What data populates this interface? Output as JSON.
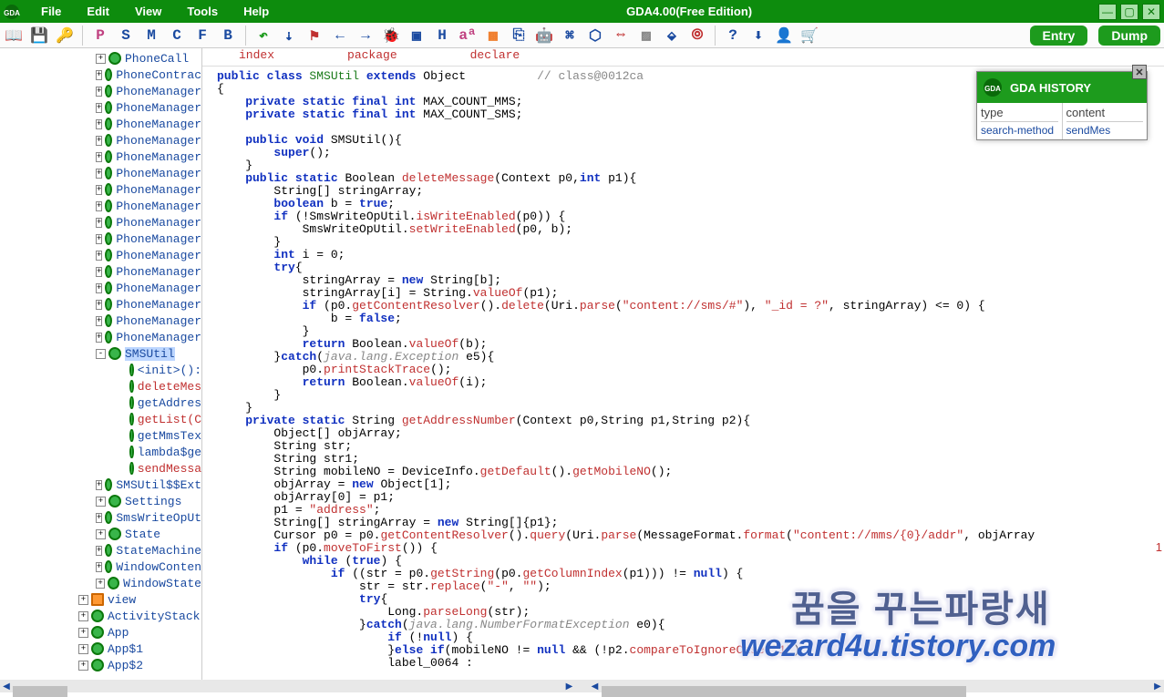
{
  "titlebar": {
    "menus": [
      "File",
      "Edit",
      "View",
      "Tools",
      "Help"
    ],
    "title": "GDA4.00(Free Edition)"
  },
  "toolbar": {
    "icons": [
      {
        "name": "open-icon",
        "glyph": "📖",
        "color": "#1a4aa0"
      },
      {
        "name": "save-icon",
        "glyph": "💾",
        "color": "#1a4aa0"
      },
      {
        "name": "key-icon",
        "glyph": "🔑",
        "color": "#c79b2a"
      }
    ],
    "letters": [
      {
        "name": "p-icon",
        "glyph": "P",
        "color": "#c04080"
      },
      {
        "name": "s-icon",
        "glyph": "S",
        "color": "#1a4aa0"
      },
      {
        "name": "m-icon",
        "glyph": "M",
        "color": "#1a4aa0"
      },
      {
        "name": "c-icon",
        "glyph": "C",
        "color": "#1a4aa0"
      },
      {
        "name": "f-icon",
        "glyph": "F",
        "color": "#1a4aa0"
      },
      {
        "name": "b-icon",
        "glyph": "B",
        "color": "#1a4aa0"
      }
    ],
    "tools": [
      {
        "name": "undo-icon",
        "glyph": "↶",
        "color": "#1d9b1d"
      },
      {
        "name": "bookmark-icon",
        "glyph": "⇣",
        "color": "#1a4aa0"
      },
      {
        "name": "flag-icon",
        "glyph": "⚑",
        "color": "#c03030"
      },
      {
        "name": "back-icon",
        "glyph": "←",
        "color": "#1a4aa0"
      },
      {
        "name": "forward-icon",
        "glyph": "→",
        "color": "#1a4aa0"
      },
      {
        "name": "bug-icon",
        "glyph": "🐞",
        "color": "#333"
      },
      {
        "name": "doc-icon",
        "glyph": "▣",
        "color": "#1a4aa0"
      },
      {
        "name": "h-icon",
        "glyph": "H",
        "color": "#1a4aa0"
      },
      {
        "name": "aa-icon",
        "glyph": "aª",
        "color": "#c04080"
      },
      {
        "name": "palette-icon",
        "glyph": "▦",
        "color": "#f08030"
      },
      {
        "name": "xml-icon",
        "glyph": "⎘",
        "color": "#1a4aa0"
      },
      {
        "name": "android-icon",
        "glyph": "🤖",
        "color": "#333"
      },
      {
        "name": "cmd-icon",
        "glyph": "⌘",
        "color": "#1a4aa0"
      },
      {
        "name": "link-icon",
        "glyph": "⬡",
        "color": "#1a4aa0"
      },
      {
        "name": "io-icon",
        "glyph": "⇔",
        "color": "#c03030"
      },
      {
        "name": "grid-icon",
        "glyph": "▨",
        "color": "#888"
      },
      {
        "name": "bucket-icon",
        "glyph": "⬙",
        "color": "#1a4aa0"
      },
      {
        "name": "finger-icon",
        "glyph": "⦾",
        "color": "#c03030"
      }
    ],
    "tools2": [
      {
        "name": "help-icon",
        "glyph": "?",
        "color": "#1a4aa0"
      },
      {
        "name": "download-icon",
        "glyph": "⬇",
        "color": "#1a4aa0"
      },
      {
        "name": "person-icon",
        "glyph": "👤",
        "color": "#333"
      },
      {
        "name": "cart-icon",
        "glyph": "🛒",
        "color": "#333"
      }
    ],
    "entry_label": "Entry",
    "dump_label": "Dump"
  },
  "tree": {
    "items": [
      {
        "indent": 105,
        "expand": "+",
        "icon": "class",
        "label": "PhoneCall"
      },
      {
        "indent": 105,
        "expand": "+",
        "icon": "class",
        "label": "PhoneContrac"
      },
      {
        "indent": 105,
        "expand": "+",
        "icon": "class",
        "label": "PhoneManager"
      },
      {
        "indent": 105,
        "expand": "+",
        "icon": "class",
        "label": "PhoneManager"
      },
      {
        "indent": 105,
        "expand": "+",
        "icon": "class",
        "label": "PhoneManager"
      },
      {
        "indent": 105,
        "expand": "+",
        "icon": "class",
        "label": "PhoneManager"
      },
      {
        "indent": 105,
        "expand": "+",
        "icon": "class",
        "label": "PhoneManager"
      },
      {
        "indent": 105,
        "expand": "+",
        "icon": "class",
        "label": "PhoneManager"
      },
      {
        "indent": 105,
        "expand": "+",
        "icon": "class",
        "label": "PhoneManager"
      },
      {
        "indent": 105,
        "expand": "+",
        "icon": "class",
        "label": "PhoneManager"
      },
      {
        "indent": 105,
        "expand": "+",
        "icon": "class",
        "label": "PhoneManager"
      },
      {
        "indent": 105,
        "expand": "+",
        "icon": "class",
        "label": "PhoneManager"
      },
      {
        "indent": 105,
        "expand": "+",
        "icon": "class",
        "label": "PhoneManager"
      },
      {
        "indent": 105,
        "expand": "+",
        "icon": "class",
        "label": "PhoneManager"
      },
      {
        "indent": 105,
        "expand": "+",
        "icon": "class",
        "label": "PhoneManager"
      },
      {
        "indent": 105,
        "expand": "+",
        "icon": "class",
        "label": "PhoneManager"
      },
      {
        "indent": 105,
        "expand": "+",
        "icon": "class",
        "label": "PhoneManager"
      },
      {
        "indent": 105,
        "expand": "+",
        "icon": "class",
        "label": "PhoneManager"
      },
      {
        "indent": 105,
        "expand": "-",
        "icon": "class",
        "label": "SMSUtil",
        "selected": true
      },
      {
        "indent": 142,
        "expand": "",
        "icon": "method",
        "label": "<init>():"
      },
      {
        "indent": 142,
        "expand": "",
        "icon": "method",
        "label": "deleteMes",
        "red": true
      },
      {
        "indent": 142,
        "expand": "",
        "icon": "method",
        "label": "getAddres"
      },
      {
        "indent": 142,
        "expand": "",
        "icon": "method",
        "label": "getList(C",
        "red": true
      },
      {
        "indent": 142,
        "expand": "",
        "icon": "method",
        "label": "getMmsTex"
      },
      {
        "indent": 142,
        "expand": "",
        "icon": "method",
        "label": "lambda$ge"
      },
      {
        "indent": 142,
        "expand": "",
        "icon": "method",
        "label": "sendMessa",
        "red": true
      },
      {
        "indent": 105,
        "expand": "+",
        "icon": "class",
        "label": "SMSUtil$$Ext"
      },
      {
        "indent": 105,
        "expand": "+",
        "icon": "class",
        "label": "Settings"
      },
      {
        "indent": 105,
        "expand": "+",
        "icon": "class",
        "label": "SmsWriteOpUt"
      },
      {
        "indent": 105,
        "expand": "+",
        "icon": "class",
        "label": "State"
      },
      {
        "indent": 105,
        "expand": "+",
        "icon": "class",
        "label": "StateMachine"
      },
      {
        "indent": 105,
        "expand": "+",
        "icon": "class",
        "label": "WindowConten"
      },
      {
        "indent": 105,
        "expand": "+",
        "icon": "class",
        "label": "WindowState"
      },
      {
        "indent": 86,
        "expand": "+",
        "icon": "pkg",
        "label": "view"
      },
      {
        "indent": 86,
        "expand": "+",
        "icon": "class",
        "label": "ActivityStack"
      },
      {
        "indent": 86,
        "expand": "+",
        "icon": "class",
        "label": "App"
      },
      {
        "indent": 86,
        "expand": "+",
        "icon": "class",
        "label": "App$1"
      },
      {
        "indent": 86,
        "expand": "+",
        "icon": "class",
        "label": "App$2"
      }
    ]
  },
  "code_tabs": {
    "index": "index",
    "package": "package",
    "declare": "declare"
  },
  "code": {
    "l1a": "public class ",
    "l1b": "SMSUtil ",
    "l1c": "extends ",
    "l1d": "Object",
    "l1e": "          // class@0012ca",
    "l2": "{",
    "l3a": "    private static final ",
    "l3b": "int ",
    "l3c": "MAX_COUNT_MMS;",
    "l4a": "    private static final ",
    "l4b": "int ",
    "l4c": "MAX_COUNT_SMS;",
    "l5": "",
    "l6a": "    public ",
    "l6b": "void ",
    "l6c": "SMSUtil(){",
    "l7a": "        super",
    "l7b": "();",
    "l8": "    }",
    "l9a": "    public static ",
    "l9b": "Boolean ",
    "l9c": "deleteMessage",
    "l9d": "(Context p0,",
    "l9e": "int ",
    "l9f": "p1){",
    "l10": "        String[] stringArray;",
    "l11a": "        boolean ",
    "l11b": "b = ",
    "l11c": "true",
    "l11d": ";",
    "l12a": "        if ",
    "l12b": "(!SmsWriteOpUtil.",
    "l12c": "isWriteEnabled",
    "l12d": "(p0)) {",
    "l13a": "            SmsWriteOpUtil.",
    "l13b": "setWriteEnabled",
    "l13c": "(p0, b);",
    "l14": "        }",
    "l15a": "        int ",
    "l15b": "i = 0;",
    "l16a": "        try",
    "l16b": "{",
    "l17a": "            stringArray = ",
    "l17b": "new ",
    "l17c": "String[b];",
    "l18a": "            stringArray[i] = String.",
    "l18b": "valueOf",
    "l18c": "(p1);",
    "l19a": "            if ",
    "l19b": "(p0.",
    "l19c": "getContentResolver",
    "l19d": "().",
    "l19e": "delete",
    "l19f": "(Uri.",
    "l19g": "parse",
    "l19h": "(",
    "l19i": "\"content://sms/#\"",
    "l19j": "), ",
    "l19k": "\"_id = ?\"",
    "l19l": ", stringArray) <= 0) {",
    "l20a": "                b = ",
    "l20b": "false",
    "l20c": ";",
    "l21": "            }",
    "l22a": "            return ",
    "l22b": "Boolean.",
    "l22c": "valueOf",
    "l22d": "(b);",
    "l23a": "        }",
    "l23b": "catch",
    "l23c": "(",
    "l23d": "java.lang.Exception",
    "l23e": " e5){",
    "l24a": "            p0.",
    "l24b": "printStackTrace",
    "l24c": "();",
    "l25a": "            return ",
    "l25b": "Boolean.",
    "l25c": "valueOf",
    "l25d": "(i);",
    "l26": "        }",
    "l27": "    }",
    "l28a": "    private static ",
    "l28b": "String ",
    "l28c": "getAddressNumber",
    "l28d": "(Context p0,String p1,String p2){",
    "l29": "        Object[] objArray;",
    "l30": "        String str;",
    "l31": "        String str1;",
    "l32a": "        String mobileNO = DeviceInfo.",
    "l32b": "getDefault",
    "l32c": "().",
    "l32d": "getMobileNO",
    "l32e": "();",
    "l33a": "        objArray = ",
    "l33b": "new ",
    "l33c": "Object[1];",
    "l34": "        objArray[0] = p1;",
    "l35a": "        p1 = ",
    "l35b": "\"address\"",
    "l35c": ";",
    "l36a": "        String[] stringArray = ",
    "l36b": "new ",
    "l36c": "String[]{p1};",
    "l37a": "        Cursor p0 = p0.",
    "l37b": "getContentResolver",
    "l37c": "().",
    "l37d": "query",
    "l37e": "(Uri.",
    "l37f": "parse",
    "l37g": "(MessageFormat.",
    "l37h": "format",
    "l37i": "(",
    "l37j": "\"content://mms/{0}/addr\"",
    "l37k": ", objArray",
    "l38a": "        if ",
    "l38b": "(p0.",
    "l38c": "moveToFirst",
    "l38d": "()) {",
    "l39a": "            while ",
    "l39b": "(",
    "l39c": "true",
    "l39d": ") {",
    "l40a": "                if ",
    "l40b": "((str = p0.",
    "l40c": "getString",
    "l40d": "(p0.",
    "l40e": "getColumnIndex",
    "l40f": "(p1))) != ",
    "l40g": "null",
    "l40h": ") {",
    "l41a": "                    str = str.",
    "l41b": "replace",
    "l41c": "(",
    "l41d": "\"-\"",
    "l41e": ", ",
    "l41f": "\"\"",
    "l41g": ");",
    "l42a": "                    try",
    "l42b": "{",
    "l43a": "                        Long.",
    "l43b": "parseLong",
    "l43c": "(str);",
    "l44a": "                    }",
    "l44b": "catch",
    "l44c": "(",
    "l44d": "java.lang.NumberFormatException",
    "l44e": " e0){",
    "l45a": "                        if ",
    "l45b": "(!",
    "l45c": "null",
    "l45d": ") {",
    "l46a": "                        }",
    "l46b": "else if",
    "l46c": "(mobileNO != ",
    "l46d": "null ",
    "l46e": "&& (!p2.",
    "l46f": "compareToIgnoreCase",
    "l46g": "(",
    "l46h": "\"1\"",
    "l46i": ")",
    "l47": "                        label_0064 :"
  },
  "history": {
    "title": "GDA HISTORY",
    "col1": "type",
    "col2": "content",
    "val1": "search-method",
    "val2": "sendMes"
  },
  "watermark": {
    "line1": "꿈을 꾸는파랑새",
    "line2": "wezard4u.tistory.com"
  },
  "rightnum": "1"
}
